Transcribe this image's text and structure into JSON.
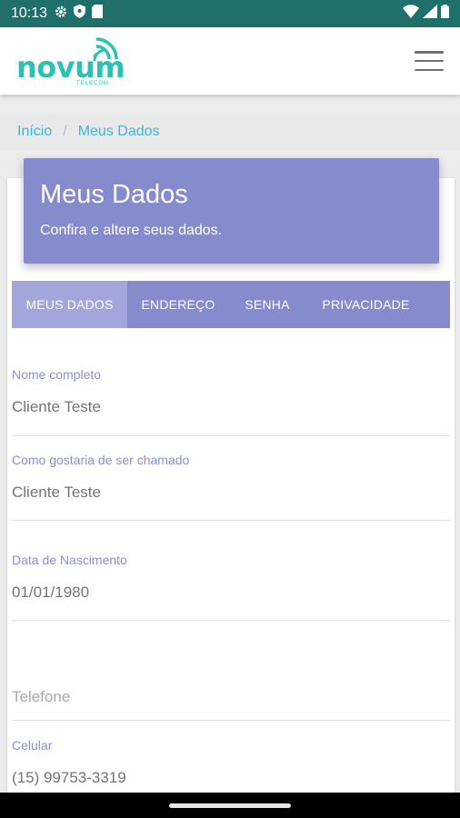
{
  "status_bar": {
    "time": "10:13",
    "icons": [
      "gear-icon",
      "shield-icon",
      "sd-card-icon",
      "wifi-icon",
      "signal-icon",
      "battery-icon"
    ]
  },
  "header": {
    "logo_text": "novum",
    "logo_subtext": "TELECOM",
    "menu_icon": "hamburger-menu-icon"
  },
  "breadcrumb": {
    "items": [
      "Início",
      "Meus Dados"
    ],
    "separator": "/"
  },
  "hero": {
    "title": "Meus Dados",
    "subtitle": "Confira e altere seus dados."
  },
  "tabs": [
    {
      "label": "MEUS DADOS",
      "active": true
    },
    {
      "label": "ENDEREÇO",
      "active": false
    },
    {
      "label": "SENHA",
      "active": false
    },
    {
      "label": "PRIVACIDADE",
      "active": false
    }
  ],
  "form": {
    "full_name": {
      "label": "Nome completo",
      "value": "Cliente Teste"
    },
    "nickname": {
      "label": "Como gostaria de ser chamado",
      "value": "Cliente Teste"
    },
    "birth_date": {
      "label": "Data de Nascimento",
      "value": "01/01/1980"
    },
    "phone": {
      "placeholder": "Telefone",
      "value": ""
    },
    "mobile": {
      "label": "Celular",
      "value": "(15) 99753-3319"
    }
  },
  "colors": {
    "status_bar": "#1f6f6b",
    "brand_teal": "#2cc1b4",
    "accent_purple": "#868bcd",
    "active_tab": "#a2a6da",
    "label": "#8b8fcf",
    "link": "#3fb6d8"
  }
}
